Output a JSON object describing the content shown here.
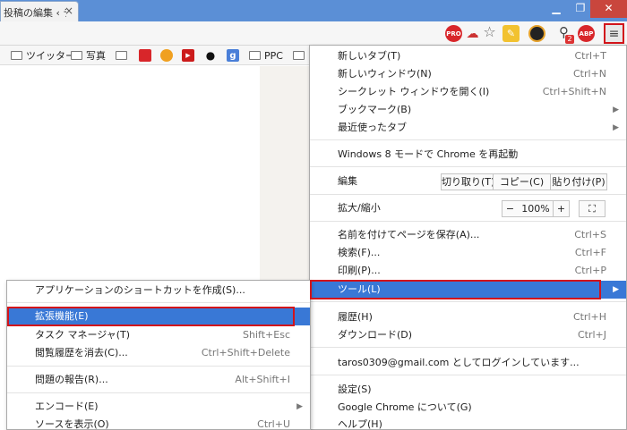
{
  "tab": {
    "title": "投稿の編集 ‹ テ",
    "close": "×"
  },
  "window": {
    "minimize": "▁",
    "maximize": "❐",
    "close": "✕"
  },
  "toolbar": {
    "icons": [
      "pro-extension-icon",
      "cloud-icon",
      "star-icon",
      "note-icon",
      "circle-extension-icon",
      "search-extension-icon",
      "adblock-plus-icon",
      "menu-icon"
    ],
    "pro_label": "PRO",
    "search_badge": "2",
    "abp_label": "ABP",
    "menu_glyph": "≡"
  },
  "bookmarks": [
    {
      "label": "ツイッター"
    },
    {
      "label": "写真"
    },
    {
      "label": ""
    },
    {
      "label": "PPC"
    }
  ],
  "main_menu": {
    "items": [
      {
        "label": "新しいタブ(T)",
        "shortcut": "Ctrl+T"
      },
      {
        "label": "新しいウィンドウ(N)",
        "shortcut": "Ctrl+N"
      },
      {
        "label": "シークレット ウィンドウを開く(I)",
        "shortcut": "Ctrl+Shift+N"
      },
      {
        "label": "ブックマーク(B)"
      },
      {
        "label": "最近使ったタブ"
      },
      {
        "label": "Windows 8 モードで Chrome を再起動"
      },
      {
        "label": "編集"
      },
      {
        "label": "拡大/縮小"
      },
      {
        "label": "名前を付けてページを保存(A)...",
        "shortcut": "Ctrl+S"
      },
      {
        "label": "検索(F)...",
        "shortcut": "Ctrl+F"
      },
      {
        "label": "印刷(P)...",
        "shortcut": "Ctrl+P"
      },
      {
        "label": "ツール(L)"
      },
      {
        "label": "履歴(H)",
        "shortcut": "Ctrl+H"
      },
      {
        "label": "ダウンロード(D)",
        "shortcut": "Ctrl+J"
      },
      {
        "label": "taros0309@gmail.com としてログインしています..."
      },
      {
        "label": "設定(S)"
      },
      {
        "label": "Google Chrome について(G)"
      },
      {
        "label": "ヘルプ(H)"
      }
    ],
    "edit_buttons": {
      "cut": "切り取り(T)",
      "copy": "コピー(C)",
      "paste": "貼り付け(P)"
    },
    "zoom": {
      "minus": "−",
      "value": "100%",
      "plus": "+",
      "fullscreen": "⛶"
    }
  },
  "sub_menu": {
    "items": [
      {
        "label": "アプリケーションのショートカットを作成(S)..."
      },
      {
        "label": "拡張機能(E)"
      },
      {
        "label": "タスク マネージャ(T)",
        "shortcut": "Shift+Esc"
      },
      {
        "label": "閲覧履歴を消去(C)...",
        "shortcut": "Ctrl+Shift+Delete"
      },
      {
        "label": "問題の報告(R)...",
        "shortcut": "Alt+Shift+I"
      },
      {
        "label": "エンコード(E)"
      },
      {
        "label": "ソースを表示(O)",
        "shortcut": "Ctrl+U"
      }
    ]
  },
  "colors": {
    "highlight": "#3978d6",
    "annotation_red": "#d2141b",
    "tabstrip": "#5b8fd6"
  }
}
